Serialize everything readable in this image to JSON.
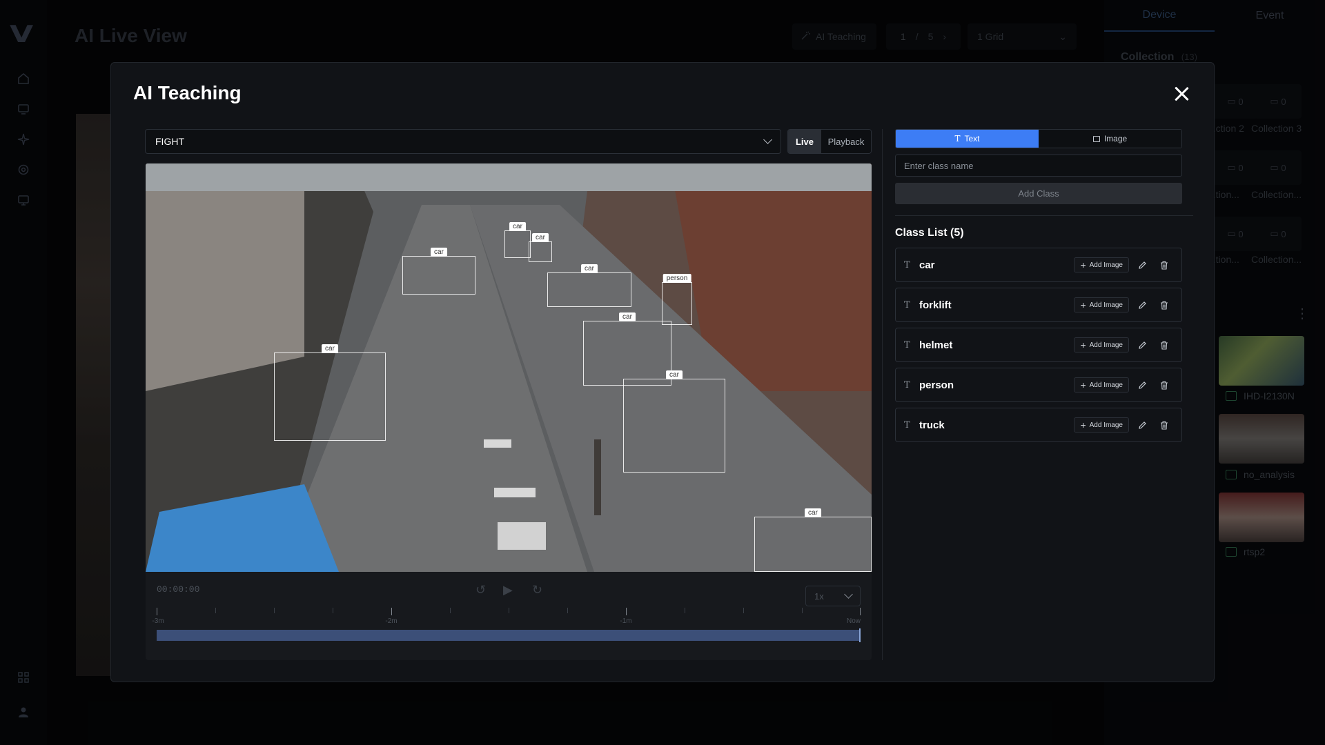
{
  "app": {
    "title": "AI Live View",
    "logo": "V",
    "toolbar": {
      "ai_teaching_label": "AI Teaching",
      "page_current": "1",
      "page_total": "5",
      "grid_value": "1 Grid"
    }
  },
  "left_nav": {
    "icons": [
      "home-icon",
      "monitor-icon",
      "sparkle-icon",
      "settings-icon",
      "monitor-settings-icon",
      "widgets-icon",
      "user-icon"
    ]
  },
  "right_panel": {
    "tabs": [
      {
        "label": "Device"
      },
      {
        "label": "Event"
      }
    ],
    "collection_title": "Collection",
    "collection_count": "(13)",
    "cards": [
      {
        "label": "...ction 2",
        "count": "0"
      },
      {
        "label": "Collection 3",
        "count": "0"
      },
      {
        "label": "...tion...",
        "count": "0"
      },
      {
        "label": "Collection...",
        "count": "0"
      },
      {
        "label": "...tion...",
        "count": "0"
      },
      {
        "label": "Collection...",
        "count": "0"
      }
    ],
    "cameras": [
      {
        "name": "IHD-I2130N"
      },
      {
        "name": "no_analysis"
      },
      {
        "name": "rtsp2"
      }
    ]
  },
  "modal": {
    "title": "AI Teaching",
    "event_select_value": "FIGHT",
    "live_label": "Live",
    "playback_label": "Playback",
    "detections": [
      {
        "label": "car"
      },
      {
        "label": "car"
      },
      {
        "label": "car"
      },
      {
        "label": "car"
      },
      {
        "label": "person"
      },
      {
        "label": "car"
      },
      {
        "label": "car"
      },
      {
        "label": "car"
      },
      {
        "label": "car"
      }
    ],
    "player": {
      "time": "00:00:00",
      "speed": "1x",
      "ticks": [
        "-3m",
        "-2m",
        "-1m",
        "Now"
      ]
    },
    "mode": {
      "text_label": "Text",
      "image_label": "Image",
      "selected": "Text"
    },
    "class_input_placeholder": "Enter class name",
    "add_class_label": "Add Class",
    "class_list_title": "Class List (5)",
    "add_image_label": "Add Image",
    "type_glyph": "T",
    "classes": [
      {
        "name": "car"
      },
      {
        "name": "forklift"
      },
      {
        "name": "helmet"
      },
      {
        "name": "person"
      },
      {
        "name": "truck"
      }
    ]
  },
  "colors": {
    "accent": "#3d7df5",
    "modal_bg": "#111317",
    "page_bg": "#050607",
    "timeline": "#3c4f78"
  }
}
